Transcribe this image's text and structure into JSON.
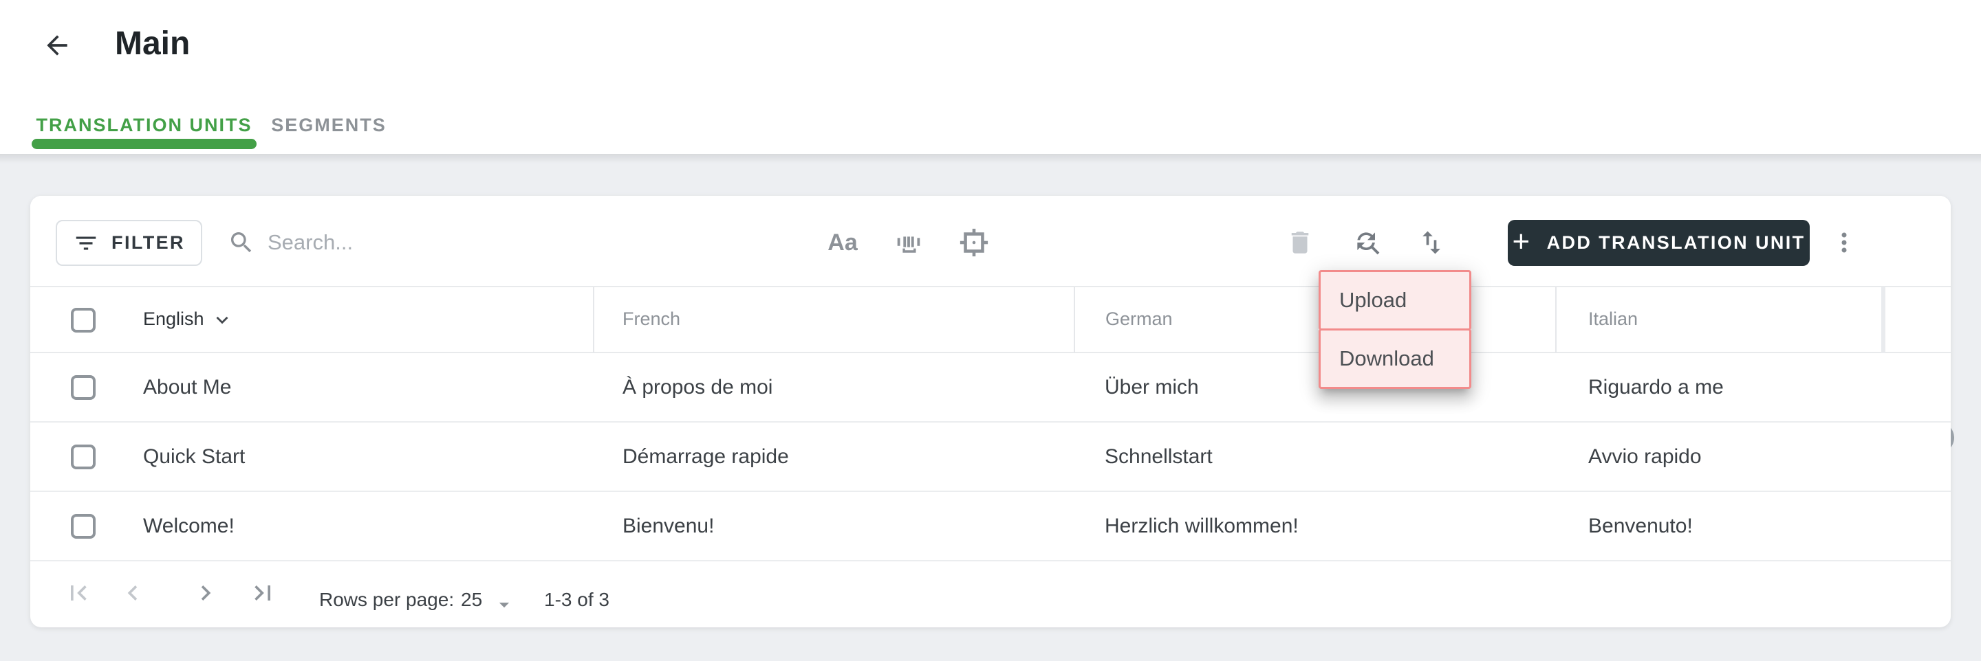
{
  "app": {
    "title": "Main"
  },
  "tabs": [
    {
      "label": "TRANSLATION UNITS",
      "active": true
    },
    {
      "label": "SEGMENTS",
      "active": false
    }
  ],
  "toolbar": {
    "filter": "FILTER",
    "search_placeholder": "Search...",
    "case_toggle": "Aa",
    "add_button": "ADD TRANSLATION UNIT",
    "add_button_plus": "+"
  },
  "context_menu": {
    "items": [
      "Upload",
      "Download"
    ]
  },
  "table": {
    "columns": [
      "English",
      "French",
      "German",
      "Italian"
    ],
    "sorted_column": "English",
    "sort_direction": "desc",
    "rows": [
      [
        "About Me",
        "À propos de moi",
        "Über mich",
        "Riguardo a me"
      ],
      [
        "Quick Start",
        "Démarrage rapide",
        "Schnellstart",
        "Avvio rapido"
      ],
      [
        "Welcome!",
        "Bienvenu!",
        "Herzlich willkommen!",
        "Benvenuto!"
      ]
    ]
  },
  "pagination": {
    "rows_per_page_label": "Rows per page:",
    "rows_per_page": "25",
    "range": "1-3 of 3"
  },
  "colors": {
    "accent_green": "#43a047",
    "dark_button": "#263238",
    "menu_highlight_fill": "#fcebeb",
    "menu_highlight_border": "#f28b8b",
    "page_bg": "#edeff2"
  },
  "icons": [
    "arrow-back",
    "filter-list",
    "search",
    "match-case",
    "match-word",
    "select-frame",
    "delete",
    "find-replace",
    "import-export",
    "more-vert",
    "add-circle",
    "sort-desc",
    "first-page",
    "chevron-left",
    "chevron-right",
    "last-page",
    "arrow-dropdown"
  ]
}
